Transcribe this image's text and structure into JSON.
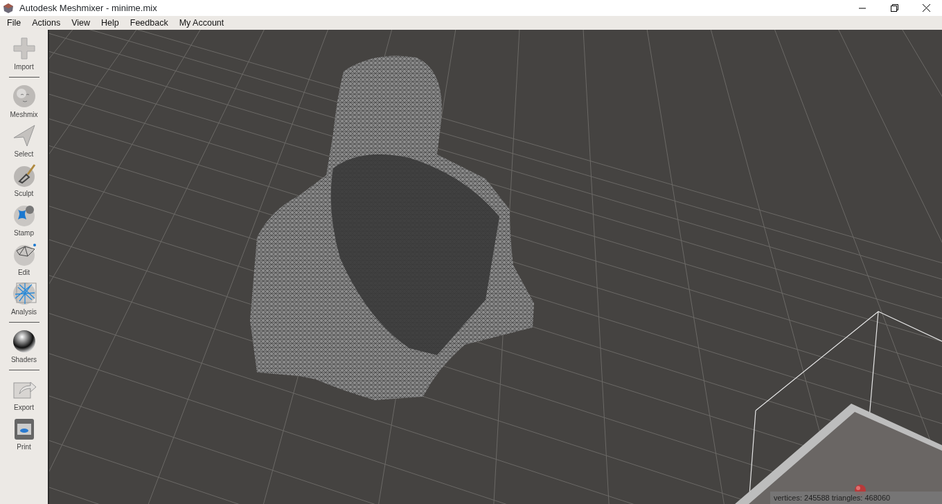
{
  "window": {
    "title": "Autodesk Meshmixer - minime.mix"
  },
  "menu": [
    "File",
    "Actions",
    "View",
    "Help",
    "Feedback",
    "My Account"
  ],
  "toolbar": {
    "groups": [
      [
        {
          "label": "Import"
        }
      ],
      [
        {
          "label": "Meshmix"
        },
        {
          "label": "Select"
        },
        {
          "label": "Sculpt"
        },
        {
          "label": "Stamp"
        },
        {
          "label": "Edit"
        },
        {
          "label": "Analysis"
        }
      ],
      [
        {
          "label": "Shaders"
        }
      ],
      [
        {
          "label": "Export"
        },
        {
          "label": "Print"
        }
      ]
    ]
  },
  "status_bar": {
    "text": "vertices: 245588 triangles: 468060"
  }
}
